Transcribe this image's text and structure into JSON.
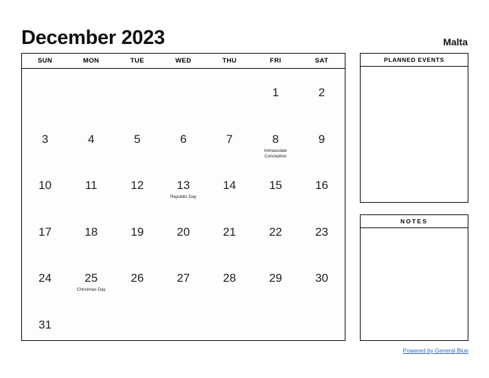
{
  "header": {
    "title": "December 2023",
    "region": "Malta"
  },
  "calendar": {
    "weekdays": [
      "SUN",
      "MON",
      "TUE",
      "WED",
      "THU",
      "FRI",
      "SAT"
    ],
    "weeks": [
      [
        {
          "day": "",
          "event": ""
        },
        {
          "day": "",
          "event": ""
        },
        {
          "day": "",
          "event": ""
        },
        {
          "day": "",
          "event": ""
        },
        {
          "day": "",
          "event": ""
        },
        {
          "day": "1",
          "event": ""
        },
        {
          "day": "2",
          "event": ""
        }
      ],
      [
        {
          "day": "3",
          "event": ""
        },
        {
          "day": "4",
          "event": ""
        },
        {
          "day": "5",
          "event": ""
        },
        {
          "day": "6",
          "event": ""
        },
        {
          "day": "7",
          "event": ""
        },
        {
          "day": "8",
          "event": "Immaculate Conception"
        },
        {
          "day": "9",
          "event": ""
        }
      ],
      [
        {
          "day": "10",
          "event": ""
        },
        {
          "day": "11",
          "event": ""
        },
        {
          "day": "12",
          "event": ""
        },
        {
          "day": "13",
          "event": "Republic Day"
        },
        {
          "day": "14",
          "event": ""
        },
        {
          "day": "15",
          "event": ""
        },
        {
          "day": "16",
          "event": ""
        }
      ],
      [
        {
          "day": "17",
          "event": ""
        },
        {
          "day": "18",
          "event": ""
        },
        {
          "day": "19",
          "event": ""
        },
        {
          "day": "20",
          "event": ""
        },
        {
          "day": "21",
          "event": ""
        },
        {
          "day": "22",
          "event": ""
        },
        {
          "day": "23",
          "event": ""
        }
      ],
      [
        {
          "day": "24",
          "event": ""
        },
        {
          "day": "25",
          "event": "Christmas Day"
        },
        {
          "day": "26",
          "event": ""
        },
        {
          "day": "27",
          "event": ""
        },
        {
          "day": "28",
          "event": ""
        },
        {
          "day": "29",
          "event": ""
        },
        {
          "day": "30",
          "event": ""
        }
      ],
      [
        {
          "day": "31",
          "event": ""
        },
        {
          "day": "",
          "event": ""
        },
        {
          "day": "",
          "event": ""
        },
        {
          "day": "",
          "event": ""
        },
        {
          "day": "",
          "event": ""
        },
        {
          "day": "",
          "event": ""
        },
        {
          "day": "",
          "event": ""
        }
      ]
    ]
  },
  "panels": {
    "planned_events_title": "PLANNED EVENTS",
    "planned_events_body": "",
    "notes_title": "NOTES",
    "notes_body": ""
  },
  "footer": {
    "link_label": "Powered by General Blue"
  },
  "colors": {
    "page_background": "#ffffff",
    "border": "#000000",
    "text": "#1a1a1a",
    "link": "#2563c9"
  }
}
